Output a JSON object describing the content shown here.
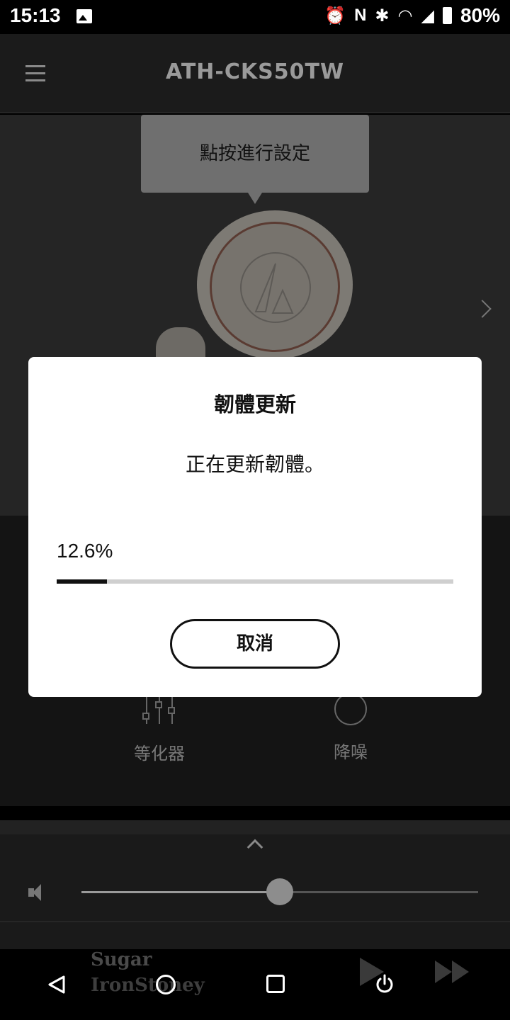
{
  "status_bar": {
    "time": "15:13",
    "battery_percent": "80%",
    "icons": [
      "image-icon",
      "alarm-icon",
      "nfc-icon",
      "bluetooth-icon",
      "wifi-icon",
      "signal-icon",
      "battery-icon"
    ]
  },
  "app_bar": {
    "title": "ATH-CKS50TW"
  },
  "hero": {
    "tooltip": "點按進行設定"
  },
  "controls": {
    "equalizer_label": "等化器",
    "noise_cancel_label": "降噪"
  },
  "player": {
    "volume_level": 0.5
  },
  "now_playing": {
    "title": "Sugar",
    "artist": "IronStoney"
  },
  "dialog": {
    "title": "韌體更新",
    "message": "正在更新韌體。",
    "progress_text": "12.6%",
    "progress_value": 0.126,
    "cancel_label": "取消"
  },
  "colors": {
    "dialog_bg": "#ffffff",
    "progress_fill": "#111111",
    "progress_track": "#cfcfcf"
  }
}
